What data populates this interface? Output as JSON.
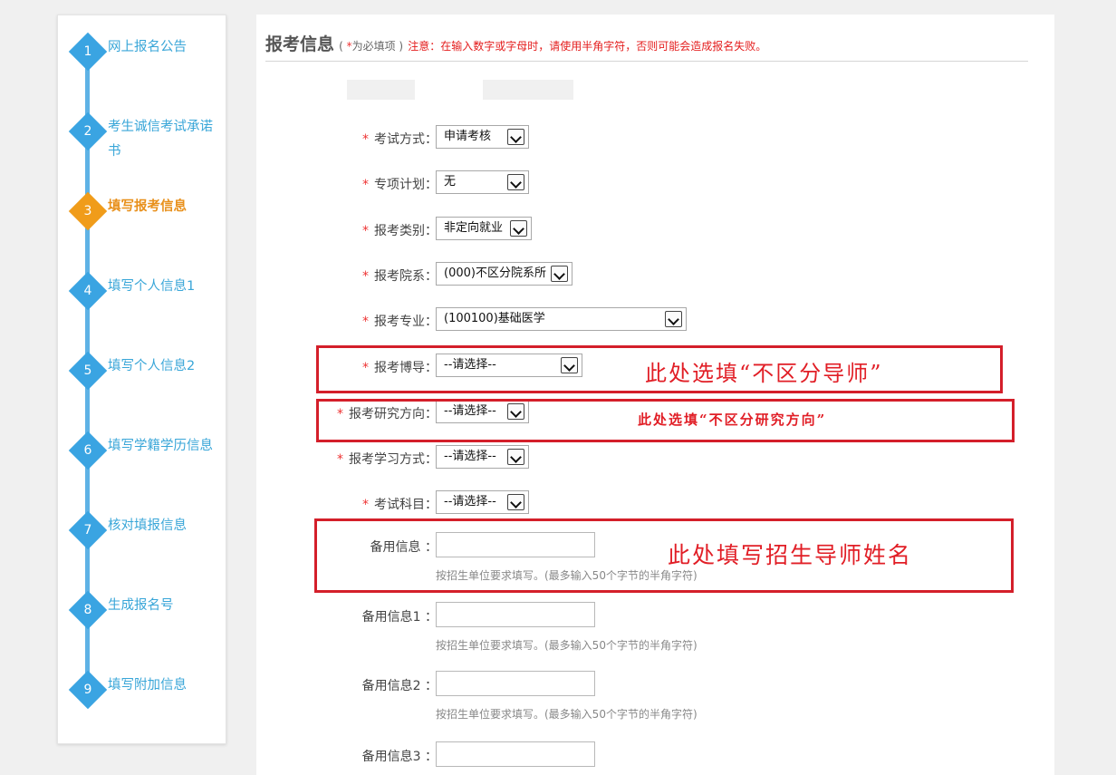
{
  "sidebar": {
    "steps": [
      {
        "num": "1",
        "label": "网上报名公告",
        "state": "done"
      },
      {
        "num": "2",
        "label": "考生诚信考试承诺书",
        "state": "done"
      },
      {
        "num": "3",
        "label": "填写报考信息",
        "state": "active"
      },
      {
        "num": "4",
        "label": "填写个人信息1",
        "state": "pending"
      },
      {
        "num": "5",
        "label": "填写个人信息2",
        "state": "pending"
      },
      {
        "num": "6",
        "label": "填写学籍学历信息",
        "state": "pending"
      },
      {
        "num": "7",
        "label": "核对填报信息",
        "state": "pending"
      },
      {
        "num": "8",
        "label": "生成报名号",
        "state": "pending"
      },
      {
        "num": "9",
        "label": "填写附加信息",
        "state": "pending"
      }
    ]
  },
  "header": {
    "title": "报考信息",
    "required_open": "( ",
    "required_star": "*",
    "required_text": "为必填项 )",
    "notice": " 注意：在输入数字或字母时，请使用半角字符，否则可能会造成报名失败。"
  },
  "form": {
    "exam_method": {
      "label": "考试方式：",
      "value": "申请考核"
    },
    "special_plan": {
      "label": "专项计划：",
      "value": "无"
    },
    "category": {
      "label": "报考类别：",
      "value": "非定向就业"
    },
    "department": {
      "label": "报考院系：",
      "value": "(000)不区分院系所"
    },
    "major": {
      "label": "报考专业：",
      "value": "(100100)基础医学"
    },
    "supervisor": {
      "label": "报考博导：",
      "value": "--请选择--"
    },
    "research_direction": {
      "label": "报考研究方向：",
      "value": "--请选择--"
    },
    "study_mode": {
      "label": "报考学习方式：",
      "value": "--请选择--"
    },
    "exam_subject": {
      "label": "考试科目：",
      "value": "--请选择--"
    },
    "backup": {
      "label": "备用信息 ：",
      "value": "",
      "hint": "按招生单位要求填写。(最多输入50个字节的半角字符)"
    },
    "backup1": {
      "label": "备用信息1 ：",
      "value": "",
      "hint": "按招生单位要求填写。(最多输入50个字节的半角字符)"
    },
    "backup2": {
      "label": "备用信息2 ：",
      "value": "",
      "hint": "按招生单位要求填写。(最多输入50个字节的半角字符)"
    },
    "backup3": {
      "label": "备用信息3 ：",
      "value": ""
    },
    "required_mark": "*"
  },
  "annotations": {
    "supervisor_note": "此处选填“不区分导师”",
    "direction_note": "此处选填“不区分研究方向”",
    "backup_note": "此处填写招生导师姓名"
  },
  "colors": {
    "accent_blue": "#3aa4e2",
    "active_orange": "#f09c1a",
    "annotation_red": "#d41f2a",
    "required_red": "#e33"
  },
  "icons": [
    "chevron-down-icon"
  ]
}
